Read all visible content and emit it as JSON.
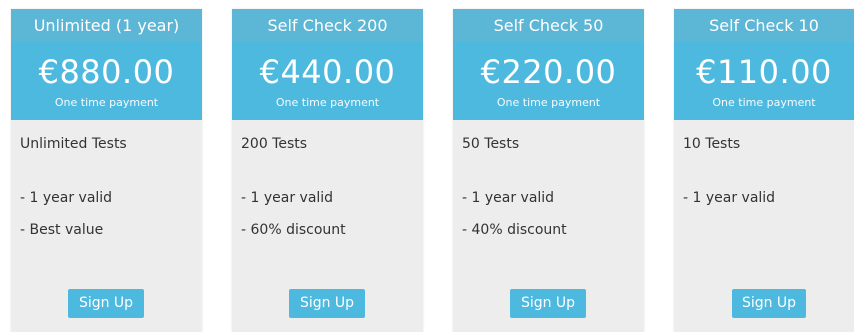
{
  "plans": [
    {
      "title": "Unlimited (1 year)",
      "price": "€880.00",
      "price_note": "One time payment",
      "tests": "Unlimited Tests",
      "features": [
        "- 1 year valid",
        "- Best value"
      ],
      "cta": "Sign Up"
    },
    {
      "title": "Self Check 200",
      "price": "€440.00",
      "price_note": "One time payment",
      "tests": "200 Tests",
      "features": [
        "- 1 year valid",
        "- 60% discount"
      ],
      "cta": "Sign Up"
    },
    {
      "title": "Self Check 50",
      "price": "€220.00",
      "price_note": "One time payment",
      "tests": "50 Tests",
      "features": [
        "- 1 year valid",
        "- 40% discount"
      ],
      "cta": "Sign Up"
    },
    {
      "title": "Self Check 10",
      "price": "€110.00",
      "price_note": "One time payment",
      "tests": "10 Tests",
      "features": [
        "- 1 year valid"
      ],
      "cta": "Sign Up"
    }
  ],
  "colors": {
    "header": "#5cb6d6",
    "price_box": "#4db9df",
    "card_bg": "#ededed",
    "button": "#4db9df",
    "text": "#333333"
  }
}
